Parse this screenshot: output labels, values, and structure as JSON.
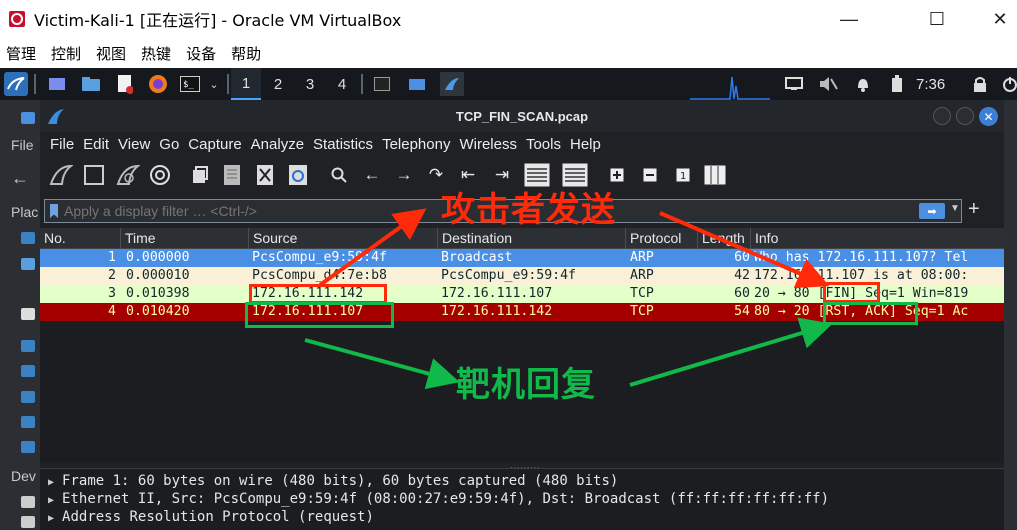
{
  "host_window": {
    "title": "Victim-Kali-1 [正在运行] - Oracle VM VirtualBox",
    "controls": {
      "minimize": "—",
      "maximize": "☐",
      "close": "✕"
    },
    "menu": [
      "管理",
      "控制",
      "视图",
      "热键",
      "设备",
      "帮助"
    ]
  },
  "kali_panel": {
    "workspaces": [
      "1",
      "2",
      "3",
      "4"
    ],
    "clock": "7:36"
  },
  "desktop_sidebar": {
    "labels": [
      "File",
      "Plac",
      "Dev"
    ]
  },
  "wireshark": {
    "title": "TCP_FIN_SCAN.pcap",
    "menu": [
      "File",
      "Edit",
      "View",
      "Go",
      "Capture",
      "Analyze",
      "Statistics",
      "Telephony",
      "Wireless",
      "Tools",
      "Help"
    ],
    "toolbar_icons": [
      "shark-fin-start-icon",
      "stop-icon",
      "restart-icon",
      "options-gear-icon",
      "open-file-icon",
      "file-set-icon",
      "close-file-icon",
      "reload-icon",
      "search-icon",
      "back-arrow-icon",
      "forward-arrow-icon",
      "go-to-packet-icon",
      "first-packet-icon",
      "last-packet-icon",
      "autoscroll-icon",
      "colorize-icon",
      "zoom-in-icon",
      "zoom-out-icon",
      "normal-size-icon",
      "resize-columns-icon"
    ],
    "filter": {
      "placeholder": "Apply a display filter … <Ctrl-/>"
    },
    "packet_list": {
      "columns": [
        "No.",
        "Time",
        "Source",
        "Destination",
        "Protocol",
        "Length",
        "Info"
      ],
      "rows": [
        {
          "no": "1",
          "time": "0.000000",
          "source": "PcsCompu_e9:59:4f",
          "destination": "Broadcast",
          "protocol": "ARP",
          "length": "60",
          "info": "Who has 172.16.111.107? Tel"
        },
        {
          "no": "2",
          "time": "0.000010",
          "source": "PcsCompu_d4:7e:b8",
          "destination": "PcsCompu_e9:59:4f",
          "protocol": "ARP",
          "length": "42",
          "info": "172.16.111.107 is at 08:00:"
        },
        {
          "no": "3",
          "time": "0.010398",
          "source": "172.16.111.142",
          "destination": "172.16.111.107",
          "protocol": "TCP",
          "length": "60",
          "info": "20 → 80 [FIN] Seq=1 Win=819"
        },
        {
          "no": "4",
          "time": "0.010420",
          "source": "172.16.111.107",
          "destination": "172.16.111.142",
          "protocol": "TCP",
          "length": "54",
          "info": "80 → 20 [RST, ACK] Seq=1 Ac"
        }
      ],
      "row_colors": {
        "selected_bg": "#4a8fe6",
        "selected_fg": "#ffffff",
        "arp_bg": "#faf0d7",
        "arp_fg": "#12272e",
        "tcp_bg": "#e4ffc7",
        "tcp_fg": "#12272e",
        "rst_bg": "#a40000",
        "rst_fg": "#fffc9c"
      }
    },
    "details": [
      "Frame 1: 60 bytes on wire (480 bits), 60 bytes captured (480 bits)",
      "Ethernet II, Src: PcsCompu_e9:59:4f (08:00:27:e9:59:4f), Dst: Broadcast (ff:ff:ff:ff:ff:ff)",
      "Address Resolution Protocol (request)"
    ]
  },
  "annotations": {
    "attacker_label": "攻击者发送",
    "target_label": "靶机回复",
    "attacker_color": "#ff2a0a",
    "target_color": "#11b84a"
  }
}
